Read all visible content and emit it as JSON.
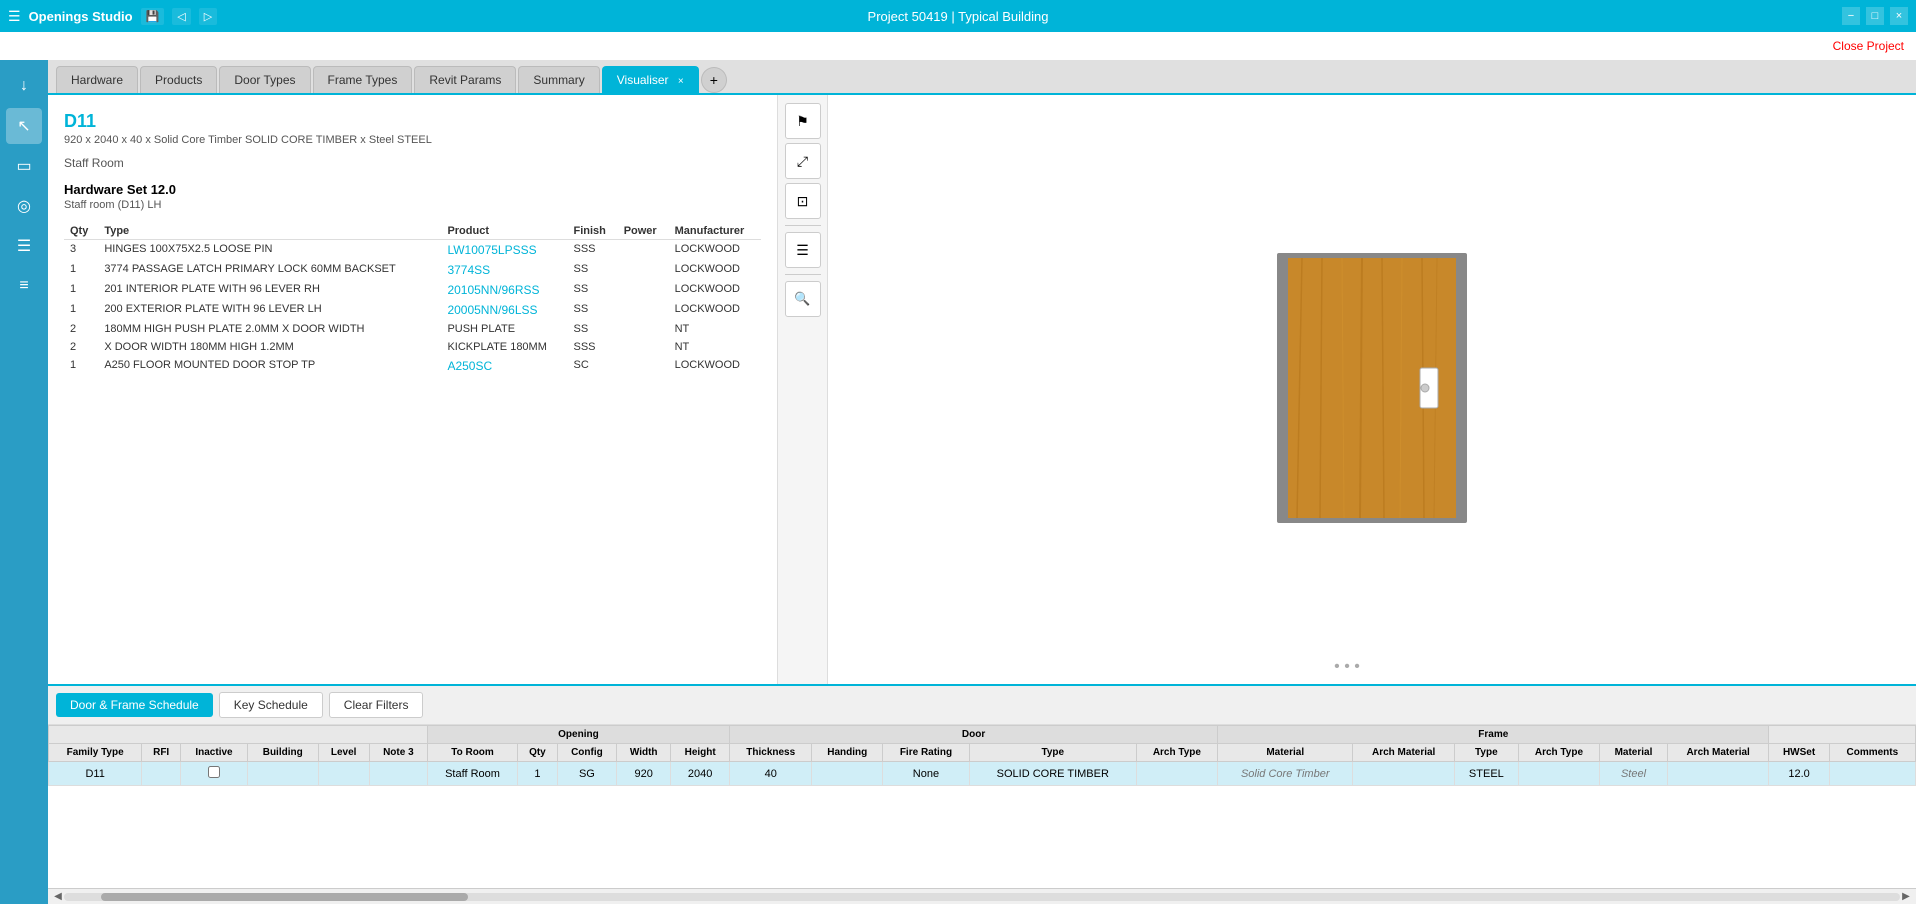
{
  "titleBar": {
    "appName": "Openings Studio",
    "projectTitle": "Project 50419 | Typical Building",
    "minBtn": "−",
    "maxBtn": "□",
    "closeBtn": "×"
  },
  "closeProject": {
    "label": "Close Project"
  },
  "tabs": [
    {
      "id": "hardware",
      "label": "Hardware",
      "active": false
    },
    {
      "id": "products",
      "label": "Products",
      "active": false
    },
    {
      "id": "doorTypes",
      "label": "Door Types",
      "active": false
    },
    {
      "id": "frameTypes",
      "label": "Frame Types",
      "active": false
    },
    {
      "id": "revitParams",
      "label": "Revit Params",
      "active": false
    },
    {
      "id": "summary",
      "label": "Summary",
      "active": false
    },
    {
      "id": "visualiser",
      "label": "Visualiser",
      "active": true
    }
  ],
  "doorInfo": {
    "id": "D11",
    "description": "920 x 2040 x 40 x Solid Core Timber SOLID CORE TIMBER x Steel STEEL",
    "room": "Staff Room",
    "hwSet": "Hardware Set 12.0",
    "hwSetSub": "Staff room (D11) LH",
    "tableHeaders": [
      "Qty",
      "Type",
      "Product",
      "Finish",
      "Power",
      "Manufacturer"
    ],
    "hardwareItems": [
      {
        "qty": "3",
        "type": "HINGES 100X75X2.5 LOOSE PIN",
        "product": "LW10075LPSSS",
        "finish": "SSS",
        "power": "",
        "manufacturer": "LOCKWOOD"
      },
      {
        "qty": "1",
        "type": "3774 PASSAGE LATCH PRIMARY LOCK 60MM BACKSET",
        "product": "3774SS",
        "finish": "SS",
        "power": "",
        "manufacturer": "LOCKWOOD"
      },
      {
        "qty": "1",
        "type": "201 INTERIOR PLATE WITH 96 LEVER RH",
        "product": "20105NN/96RSS",
        "finish": "SS",
        "power": "",
        "manufacturer": "LOCKWOOD"
      },
      {
        "qty": "1",
        "type": "200 EXTERIOR PLATE WITH 96 LEVER LH",
        "product": "20005NN/96LSS",
        "finish": "SS",
        "power": "",
        "manufacturer": "LOCKWOOD"
      },
      {
        "qty": "2",
        "type": "180MM HIGH PUSH PLATE 2.0MM X DOOR WIDTH",
        "product": "PUSH PLATE",
        "finish": "SS",
        "power": "",
        "manufacturer": "NT"
      },
      {
        "qty": "2",
        "type": "X DOOR WIDTH 180MM HIGH 1.2MM",
        "product": "KICKPLATE 180MM",
        "finish": "SSS",
        "power": "",
        "manufacturer": "NT"
      },
      {
        "qty": "1",
        "type": "A250 FLOOR MOUNTED DOOR STOP TP",
        "product": "A250SC",
        "finish": "SC",
        "power": "",
        "manufacturer": "LOCKWOOD"
      }
    ],
    "productLinks": [
      "LW10075LPSSS",
      "3774SS",
      "20105NN/96RSS",
      "20005NN/96LSS",
      "A250SC"
    ]
  },
  "sidebar": {
    "icons": [
      {
        "id": "download",
        "symbol": "↓",
        "active": false
      },
      {
        "id": "cursor",
        "symbol": "↖",
        "active": true
      },
      {
        "id": "document",
        "symbol": "▭",
        "active": false
      },
      {
        "id": "globe",
        "symbol": "◎",
        "active": false
      },
      {
        "id": "list",
        "symbol": "☰",
        "active": false
      },
      {
        "id": "menu2",
        "symbol": "≡",
        "active": false
      }
    ]
  },
  "visualiserToolbar": [
    {
      "id": "flag",
      "symbol": "⚑"
    },
    {
      "id": "zoom",
      "symbol": "⤢"
    },
    {
      "id": "enter",
      "symbol": "⬚"
    },
    {
      "id": "list",
      "symbol": "☰"
    },
    {
      "id": "search",
      "symbol": "🔍"
    }
  ],
  "scheduleTabs": {
    "doorFrameLabel": "Door & Frame Schedule",
    "keyScheduleLabel": "Key Schedule",
    "clearFiltersLabel": "Clear Filters"
  },
  "scheduleTable": {
    "groupHeaders": [
      {
        "label": "",
        "colspan": 8
      },
      {
        "label": "Opening",
        "colspan": 5
      },
      {
        "label": "Door",
        "colspan": 5
      },
      {
        "label": "Frame",
        "colspan": 6
      },
      {
        "label": "",
        "colspan": 2
      }
    ],
    "columnHeaders": [
      "Family Type",
      "RFI",
      "Inactive",
      "Building",
      "Level",
      "Note 3",
      "To Room",
      "Qty",
      "Config",
      "Width",
      "Height",
      "Thickness",
      "Handing",
      "Fire Rating",
      "Type",
      "Arch Type",
      "Material",
      "Arch Material",
      "Type",
      "Arch Type",
      "Material",
      "Arch Material",
      "HWSet",
      "Comments"
    ],
    "rows": [
      {
        "selected": true,
        "familyType": "D11",
        "rfi": "",
        "inactive": "",
        "building": "",
        "level": "",
        "note3": "",
        "toRoom": "Staff Room",
        "qty": "1",
        "config": "SG",
        "width": "920",
        "height": "2040",
        "thickness": "40",
        "handing": "",
        "fireRating": "None",
        "doorType": "SOLID CORE TIMBER",
        "doorArchType": "",
        "doorMaterial": "Solid Core Timber",
        "doorArchMaterial": "",
        "frameType": "STEEL",
        "frameArchType": "",
        "frameMaterial": "Steel",
        "frameArchMaterial": "",
        "hwSet": "12.0",
        "comments": ""
      }
    ]
  }
}
